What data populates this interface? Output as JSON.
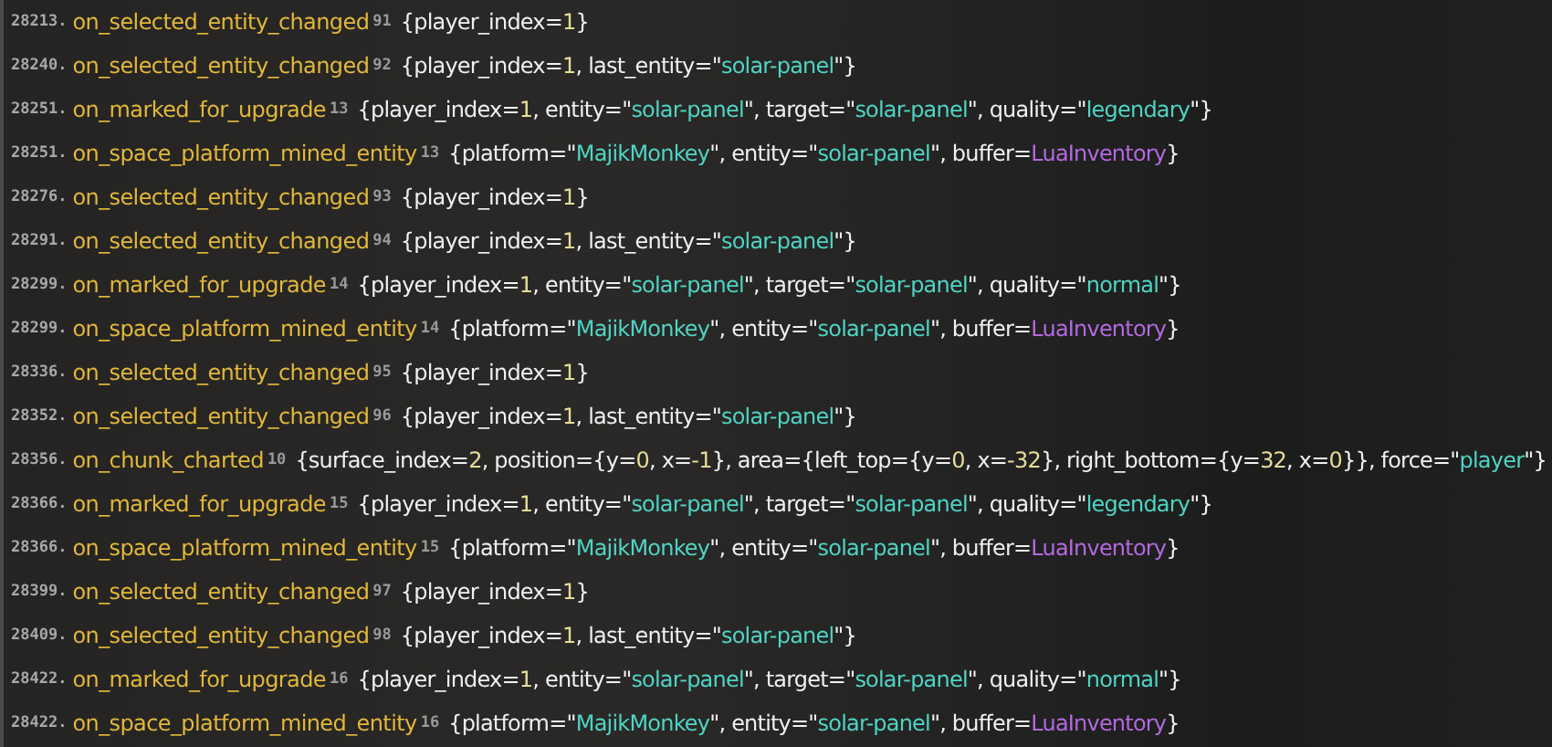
{
  "log": [
    {
      "tick": "28213.",
      "event": "on_selected_entity_changed",
      "count": "91",
      "args": "{player_index=1}"
    },
    {
      "tick": "28240.",
      "event": "on_selected_entity_changed",
      "count": "92",
      "args": "{player_index=1, last_entity=\"solar-panel\"}"
    },
    {
      "tick": "28251.",
      "event": "on_marked_for_upgrade",
      "count": "13",
      "args": "{player_index=1, entity=\"solar-panel\", target=\"solar-panel\", quality=\"legendary\"}"
    },
    {
      "tick": "28251.",
      "event": "on_space_platform_mined_entity",
      "count": "13",
      "args": "{platform=\"MajikMonkey\", entity=\"solar-panel\", buffer=LuaInventory}"
    },
    {
      "tick": "28276.",
      "event": "on_selected_entity_changed",
      "count": "93",
      "args": "{player_index=1}"
    },
    {
      "tick": "28291.",
      "event": "on_selected_entity_changed",
      "count": "94",
      "args": "{player_index=1, last_entity=\"solar-panel\"}"
    },
    {
      "tick": "28299.",
      "event": "on_marked_for_upgrade",
      "count": "14",
      "args": "{player_index=1, entity=\"solar-panel\", target=\"solar-panel\", quality=\"normal\"}"
    },
    {
      "tick": "28299.",
      "event": "on_space_platform_mined_entity",
      "count": "14",
      "args": "{platform=\"MajikMonkey\", entity=\"solar-panel\", buffer=LuaInventory}"
    },
    {
      "tick": "28336.",
      "event": "on_selected_entity_changed",
      "count": "95",
      "args": "{player_index=1}"
    },
    {
      "tick": "28352.",
      "event": "on_selected_entity_changed",
      "count": "96",
      "args": "{player_index=1, last_entity=\"solar-panel\"}"
    },
    {
      "tick": "28356.",
      "event": "on_chunk_charted",
      "count": "10",
      "args": "{surface_index=2, position={y=0, x=-1}, area={left_top={y=0, x=-32}, right_bottom={y=32, x=0}}, force=\"player\"}"
    },
    {
      "tick": "28366.",
      "event": "on_marked_for_upgrade",
      "count": "15",
      "args": "{player_index=1, entity=\"solar-panel\", target=\"solar-panel\", quality=\"legendary\"}"
    },
    {
      "tick": "28366.",
      "event": "on_space_platform_mined_entity",
      "count": "15",
      "args": "{platform=\"MajikMonkey\", entity=\"solar-panel\", buffer=LuaInventory}"
    },
    {
      "tick": "28399.",
      "event": "on_selected_entity_changed",
      "count": "97",
      "args": "{player_index=1}"
    },
    {
      "tick": "28409.",
      "event": "on_selected_entity_changed",
      "count": "98",
      "args": "{player_index=1, last_entity=\"solar-panel\"}"
    },
    {
      "tick": "28422.",
      "event": "on_marked_for_upgrade",
      "count": "16",
      "args": "{player_index=1, entity=\"solar-panel\", target=\"solar-panel\", quality=\"normal\"}"
    },
    {
      "tick": "28422.",
      "event": "on_space_platform_mined_entity",
      "count": "16",
      "args": "{platform=\"MajikMonkey\", entity=\"solar-panel\", buffer=LuaInventory}"
    }
  ]
}
